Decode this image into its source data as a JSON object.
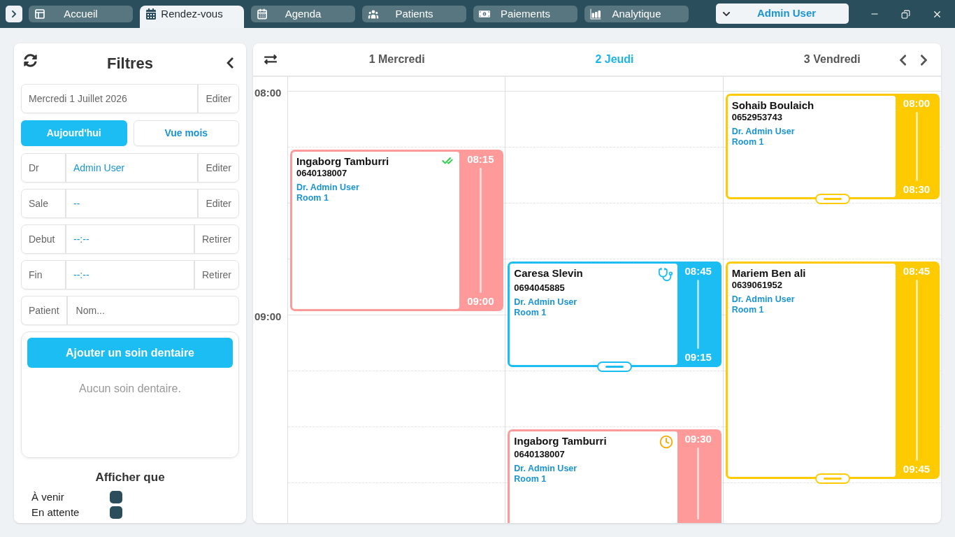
{
  "top_bar": {
    "tabs": [
      {
        "label": "Accueil",
        "selected": false
      },
      {
        "label": "Rendez-vous",
        "selected": true
      },
      {
        "label": "Agenda",
        "selected": false
      },
      {
        "label": "Patients",
        "selected": false
      },
      {
        "label": "Paiements",
        "selected": false
      },
      {
        "label": "Analytique",
        "selected": false
      }
    ],
    "user_menu": {
      "label": "Admin User"
    }
  },
  "filters": {
    "title": "Filtres",
    "date": {
      "value": "Mercredi 1 Juillet 2026",
      "action": "Editer"
    },
    "view_buttons": [
      {
        "label": "Aujourd'hui",
        "selected": true
      },
      {
        "label": "Vue mois",
        "selected": false
      }
    ],
    "rows": [
      {
        "kind": "value",
        "label": "Dr",
        "value": "Admin User",
        "action": "Editer"
      },
      {
        "kind": "value",
        "label": "Sale",
        "value": "--",
        "action": "Editer"
      },
      {
        "kind": "value",
        "label": "Debut",
        "value": "--:--",
        "action": "Retirer"
      },
      {
        "kind": "value",
        "label": "Fin",
        "value": "--:--",
        "action": "Retirer"
      },
      {
        "kind": "input",
        "label": "Patient",
        "placeholder": "Nom..."
      }
    ],
    "dental_care": {
      "button": "Ajouter un soin dentaire",
      "empty_text": "Aucun soin dentaire."
    },
    "show_only": {
      "title": "Afficher que",
      "options": [
        {
          "label": "À venir",
          "checked": true
        },
        {
          "label": "En attente",
          "checked": true
        }
      ]
    }
  },
  "calendar": {
    "time_labels": [
      "08:00",
      "09:00"
    ],
    "days": [
      {
        "label": "1 Mercredi",
        "selected": false,
        "events": [
          {
            "kind": "confirmed",
            "patient": "Ingaborg Tamburri",
            "phone": "0640138007",
            "doctor": "Dr. Admin User",
            "room": "Room 1",
            "start": "08:15",
            "end": "09:00",
            "color": "#fe9a9a",
            "resizable": false
          }
        ]
      },
      {
        "label": "2 Jeudi",
        "selected": true,
        "events": [
          {
            "kind": "consultation",
            "patient": "Caresa Slevin",
            "phone": "0694045885",
            "doctor": "Dr. Admin User",
            "room": "Room 1",
            "start": "08:45",
            "end": "09:15",
            "color": "#1bbdf2",
            "resizable": true
          },
          {
            "kind": "waiting",
            "patient": "Ingaborg Tamburri",
            "phone": "0640138007",
            "doctor": "Dr. Admin User",
            "room": "Room 1",
            "start": "09:30",
            "color": "#fe9a9a",
            "resizable": false
          }
        ]
      },
      {
        "label": "3 Vendredi",
        "selected": false,
        "events": [
          {
            "kind": "scheduled",
            "patient": "Sohaib Boulaich",
            "phone": "0652953743",
            "doctor": "Dr. Admin User",
            "room": "Room 1",
            "start": "08:00",
            "end": "08:30",
            "color": "#fecb00",
            "resizable": true
          },
          {
            "kind": "scheduled",
            "patient": "Mariem Ben ali",
            "phone": "0639061952",
            "doctor": "Dr. Admin User",
            "room": "Room 1",
            "start": "08:45",
            "end": "09:45",
            "color": "#fecb00",
            "resizable": true
          }
        ]
      }
    ]
  }
}
